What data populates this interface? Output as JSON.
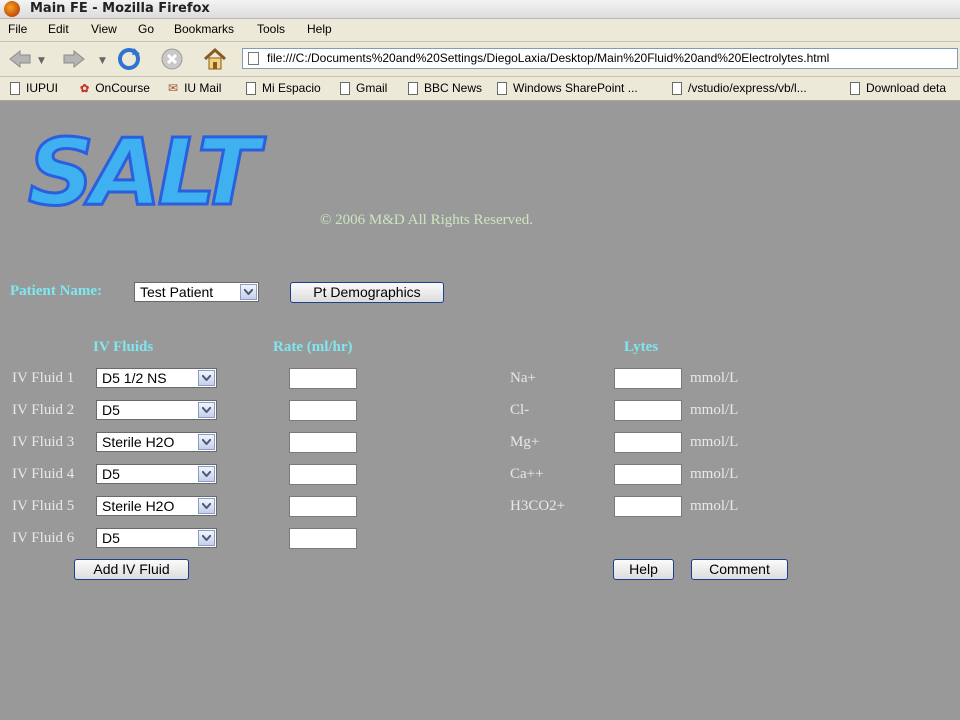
{
  "window": {
    "title": "Main FE - Mozilla Firefox"
  },
  "menu": [
    "File",
    "Edit",
    "View",
    "Go",
    "Bookmarks",
    "Tools",
    "Help"
  ],
  "nav": {
    "url": "file:///C:/Documents%20and%20Settings/DiegoLaxia/Desktop/Main%20Fluid%20and%20Electrolytes.html"
  },
  "bookmarks": [
    "IUPUI",
    "OnCourse",
    "IU Mail",
    "Mi Espacio",
    "Gmail",
    "BBC News",
    "Windows SharePoint ...",
    "/vstudio/express/vb/l...",
    "Download deta"
  ],
  "header": {
    "logo_text": "SALT",
    "copyright": "© 2006 M&D All Rights Reserved."
  },
  "patient": {
    "label": "Patient Name:",
    "value": "Test Patient",
    "demographics_button": "Pt Demographics"
  },
  "columns": {
    "fluids": "IV Fluids",
    "rate": "Rate (ml/hr)",
    "lytes": "Lytes"
  },
  "fluids": [
    {
      "label": "IV Fluid 1",
      "value": "D5 1/2 NS",
      "rate": ""
    },
    {
      "label": "IV Fluid 2",
      "value": "D5",
      "rate": ""
    },
    {
      "label": "IV Fluid 3",
      "value": "Sterile H2O",
      "rate": ""
    },
    {
      "label": "IV Fluid 4",
      "value": "D5",
      "rate": ""
    },
    {
      "label": "IV Fluid 5",
      "value": "Sterile H2O",
      "rate": ""
    },
    {
      "label": "IV Fluid 6",
      "value": "D5",
      "rate": ""
    }
  ],
  "lytes": [
    {
      "label": "Na+",
      "value": "",
      "unit": "mmol/L"
    },
    {
      "label": "Cl-",
      "value": "",
      "unit": "mmol/L"
    },
    {
      "label": "Mg+",
      "value": "",
      "unit": "mmol/L"
    },
    {
      "label": "Ca++",
      "value": "",
      "unit": "mmol/L"
    },
    {
      "label": "H3CO2+",
      "value": "",
      "unit": "mmol/L"
    }
  ],
  "buttons": {
    "add_fluid": "Add IV Fluid",
    "help": "Help",
    "comment": "Comment"
  },
  "colors": {
    "page_bg": "#999999",
    "label_cyan": "#7fe7f0",
    "chrome": "#ece9d8"
  },
  "icons": [
    "firefox-icon",
    "back-icon",
    "forward-icon",
    "reload-icon",
    "stop-icon",
    "home-icon",
    "page-icon",
    "dropdown-arrow-icon"
  ]
}
